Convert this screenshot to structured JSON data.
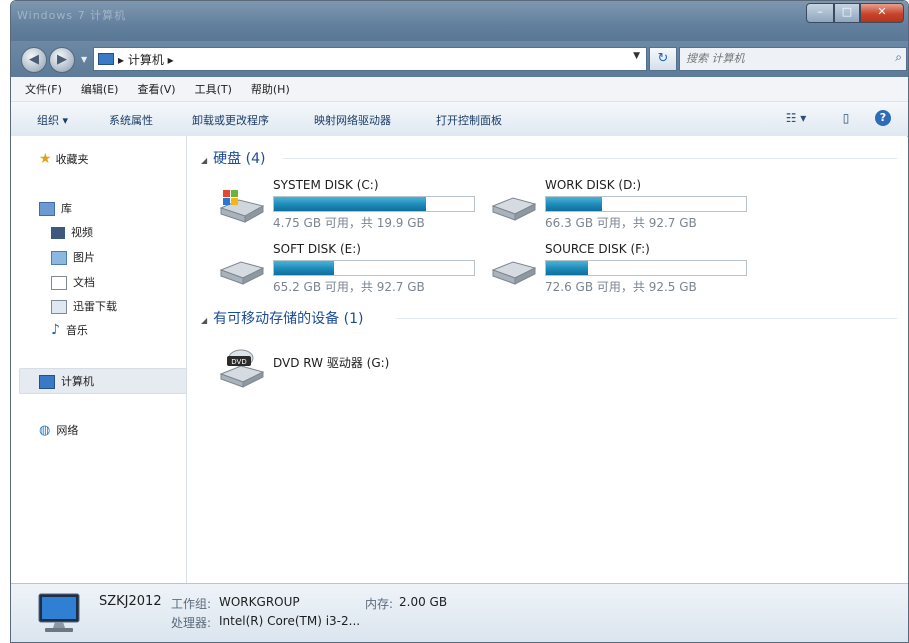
{
  "window": {
    "title_blur": "Windows 7 计算机"
  },
  "address_bar": {
    "crumb": "计算机",
    "search_placeholder": "搜索 计算机"
  },
  "menu": [
    "文件(F)",
    "编辑(E)",
    "查看(V)",
    "工具(T)",
    "帮助(H)"
  ],
  "toolbar": {
    "organize": "组织 ▾",
    "system_properties": "系统属性",
    "uninstall": "卸载或更改程序",
    "map_drive": "映射网络驱动器",
    "control_panel": "打开控制面板"
  },
  "sidebar": {
    "favorites": "收藏夹",
    "libraries": "库",
    "lib_items": [
      "视频",
      "图片",
      "文档",
      "迅雷下载",
      "音乐"
    ],
    "computer": "计算机",
    "network": "网络"
  },
  "content": {
    "hdd_group": "硬盘 (4)",
    "removable_group": "有可移动存储的设备 (1)",
    "drives": [
      {
        "name": "SYSTEM DISK (C:)",
        "free": "4.75 GB 可用，共 19.9 GB",
        "used_fraction": 0.76
      },
      {
        "name": "WORK DISK (D:)",
        "free": "66.3 GB 可用，共 92.7 GB",
        "used_fraction": 0.28
      },
      {
        "name": "SOFT DISK (E:)",
        "free": "65.2 GB 可用，共 92.7 GB",
        "used_fraction": 0.3
      },
      {
        "name": "SOURCE DISK (F:)",
        "free": "72.6 GB 可用，共 92.5 GB",
        "used_fraction": 0.21
      }
    ],
    "dvd": {
      "name": "DVD RW 驱动器 (G:)",
      "badge": "DVD"
    }
  },
  "details": {
    "computer_name": "SZKJ2012",
    "workgroup_label": "工作组:",
    "workgroup": "WORKGROUP",
    "memory_label": "内存:",
    "memory": "2.00 GB",
    "processor_label": "处理器:",
    "processor": "Intel(R) Core(TM) i3-2..."
  },
  "colors": {
    "title": "#62809d",
    "bar_fill": "#1a86b4",
    "group_text": "#1b4c96",
    "details_bg": "#e3ebf3"
  }
}
